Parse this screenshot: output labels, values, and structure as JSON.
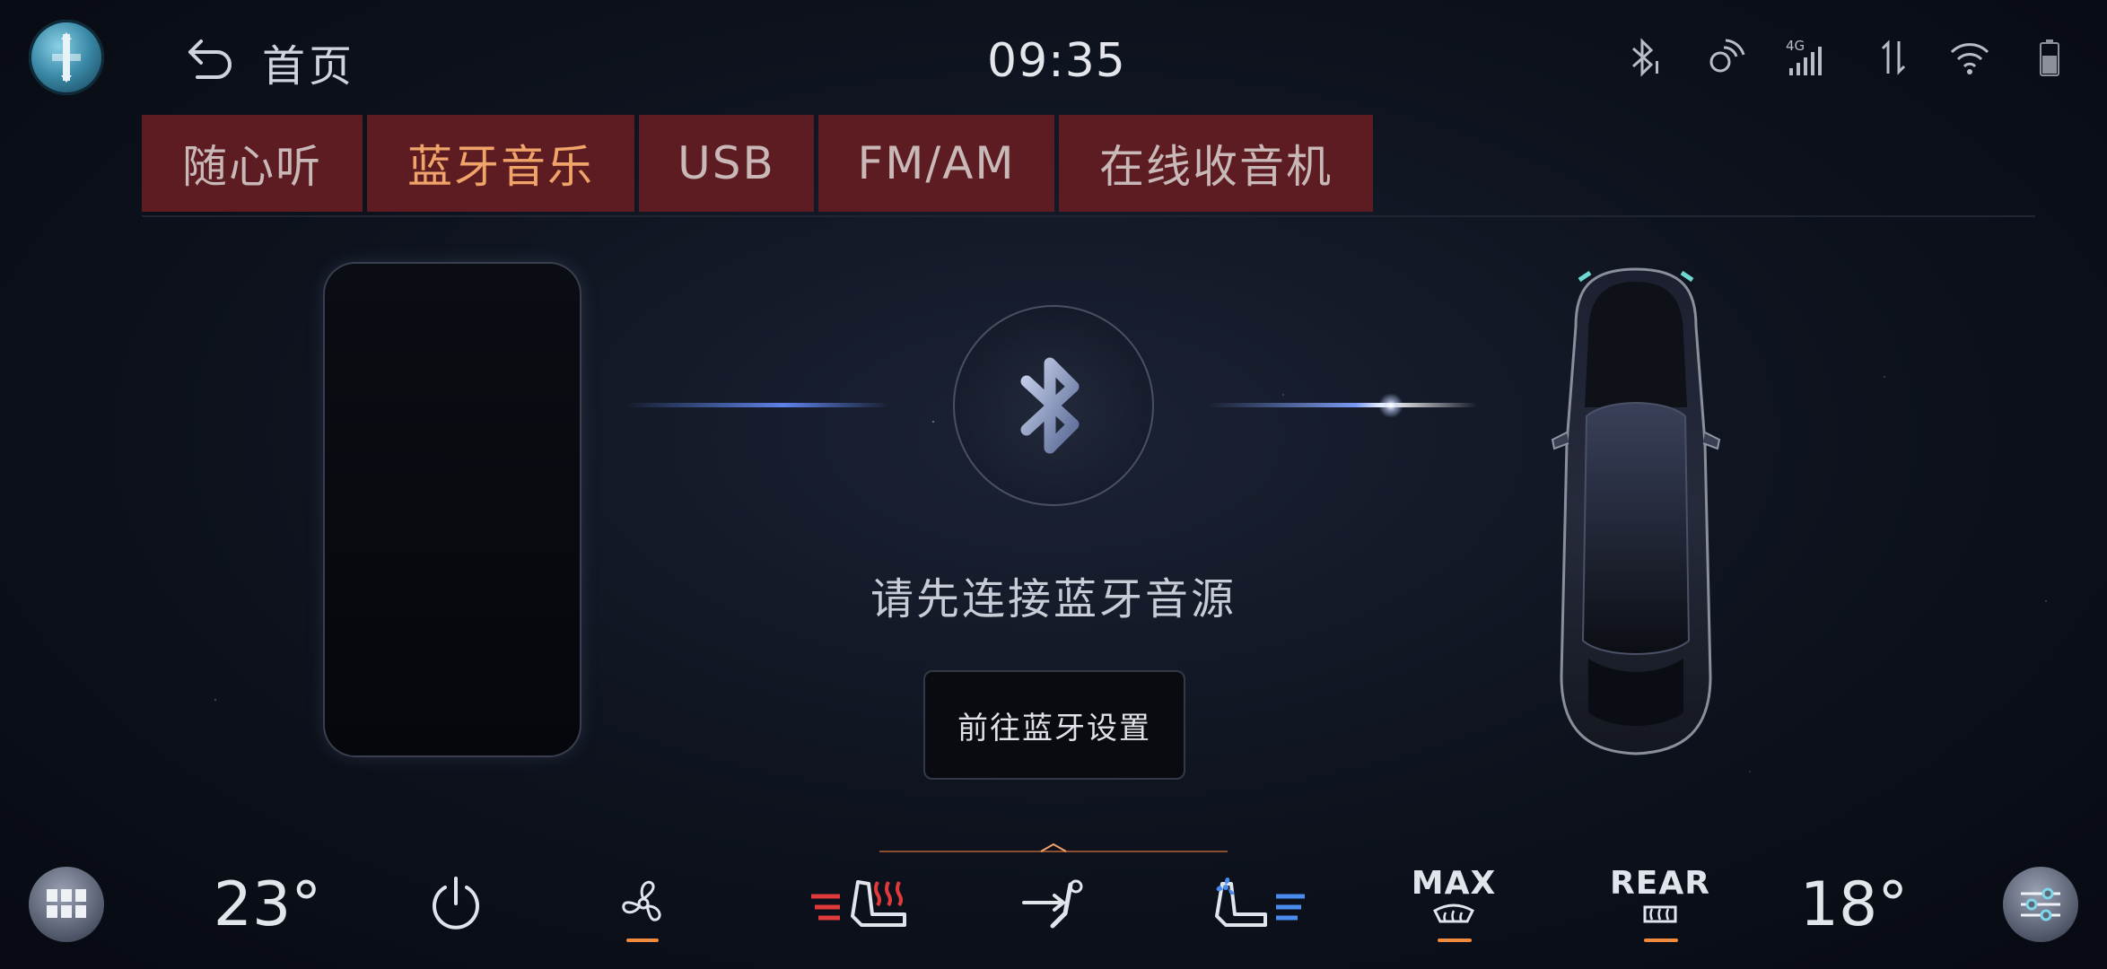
{
  "header": {
    "home_label": "首页",
    "time": "09:35",
    "status_icons": [
      "bluetooth-icon",
      "voice-assistant-icon",
      "signal-4g-icon",
      "data-transfer-icon",
      "wifi-icon",
      "battery-icon"
    ],
    "signal_type": "4G"
  },
  "tabs": [
    {
      "label": "随心听",
      "active": false
    },
    {
      "label": "蓝牙音乐",
      "active": true
    },
    {
      "label": "USB",
      "active": false
    },
    {
      "label": "FM/AM",
      "active": false
    },
    {
      "label": "在线收音机",
      "active": false
    }
  ],
  "main": {
    "prompt": "请先连接蓝牙音源",
    "goto_button": "前往蓝牙设置"
  },
  "climate": {
    "left_temp": "23°",
    "right_temp": "18°",
    "max_label": "MAX",
    "rear_label": "REAR"
  },
  "colors": {
    "tab_bg": "#5c1c22",
    "tab_active_text": "#f0a469",
    "accent_orange": "#f08a3c",
    "accent_blue": "#4b8cf0",
    "heat_red": "#e03a3a"
  }
}
